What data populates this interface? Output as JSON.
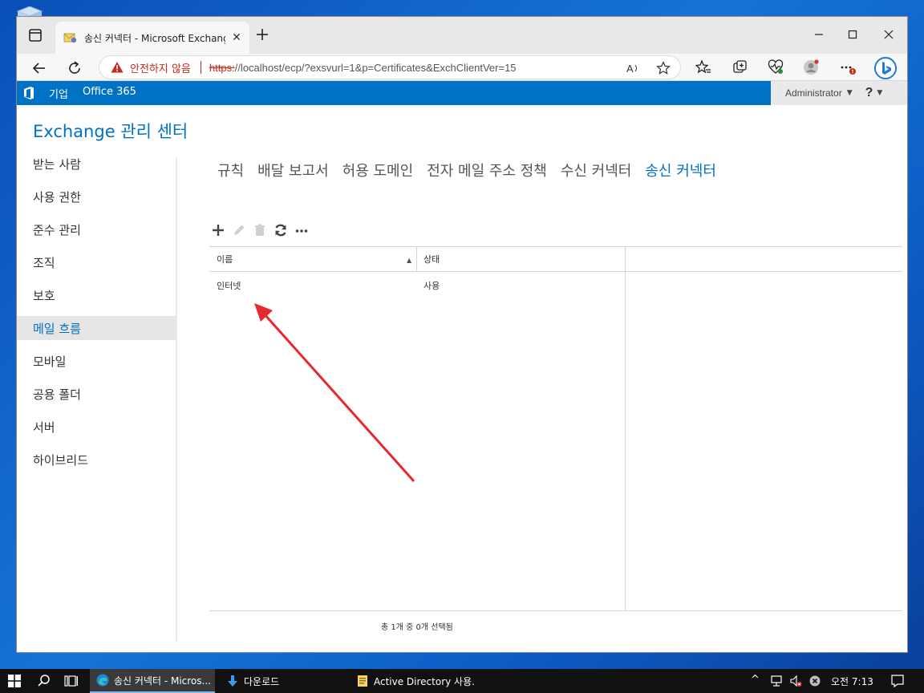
{
  "browser": {
    "tab_title": "송신 커넥터 - Microsoft Exchange",
    "url_warning": "안전하지 않음",
    "url_scheme": "https:",
    "url_rest": "//localhost/ecp/?exsvurl=1&p=Certificates&ExchClientVer=15"
  },
  "o365bar": {
    "enterprise": "기업",
    "office365": "Office 365",
    "user": "Administrator",
    "help": "?"
  },
  "eac": {
    "title": "Exchange 관리 센터"
  },
  "leftnav": {
    "items": [
      {
        "label": "받는 사람"
      },
      {
        "label": "사용 권한"
      },
      {
        "label": "준수 관리"
      },
      {
        "label": "조직"
      },
      {
        "label": "보호"
      },
      {
        "label": "메일 흐름",
        "active": true
      },
      {
        "label": "모바일"
      },
      {
        "label": "공용 폴더"
      },
      {
        "label": "서버"
      },
      {
        "label": "하이브리드"
      }
    ]
  },
  "subnav": {
    "tabs": [
      {
        "label": "규칙"
      },
      {
        "label": "배달 보고서"
      },
      {
        "label": "허용 도메인"
      },
      {
        "label": "전자 메일 주소 정책"
      },
      {
        "label": "수신 커넥터"
      },
      {
        "label": "송신 커넥터",
        "active": true
      }
    ]
  },
  "grid": {
    "columns": [
      "이름",
      "상태"
    ],
    "rows": [
      {
        "name": "인터넷",
        "status": "사용"
      }
    ],
    "status_text": "총 1개 중 0개 선택됨"
  },
  "taskbar": {
    "apps": [
      {
        "label": "송신 커넥터 - Micros..."
      },
      {
        "label": "다운로드"
      },
      {
        "label": "Active Directory 사용..."
      }
    ],
    "clock": "오전 7:13"
  },
  "colors": {
    "accent": "#0072c6",
    "warning": "#c42b1c",
    "arrow": "#e8282c"
  }
}
